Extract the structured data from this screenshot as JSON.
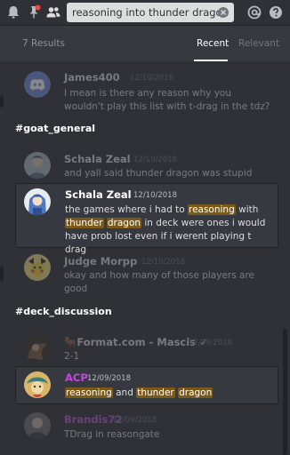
{
  "search": {
    "query": "reasoning into thunder dragon"
  },
  "results": {
    "count_label": "7 Results",
    "sort_tabs": [
      "Recent",
      "Relevant"
    ],
    "active_tab": "Recent"
  },
  "groups": [
    {
      "channel": "",
      "messages": [
        {
          "author": "James400",
          "timestamp": "12/10/2018",
          "content": "I mean is there any reason why you wouldn't play this list with t-drag in the tdz?"
        }
      ]
    },
    {
      "channel": "#goat_general",
      "messages": [
        {
          "author": "Schala Zeal",
          "timestamp": "12/10/2018",
          "content": "and yall said thunder dragon was stupid"
        },
        {
          "author": "Schala Zeal",
          "timestamp": "12/10/2018",
          "segments": [
            "the games where i had to ",
            "reasoning",
            " with ",
            "thunder",
            " ",
            "dragon",
            " in deck were ones i would have prob lost even if i werent playing t drag"
          ]
        },
        {
          "author": "Judge Morpp",
          "timestamp": "12/10/2018",
          "content": "okay and how many of those players are good"
        }
      ]
    },
    {
      "channel": "#deck_discussion",
      "messages": [
        {
          "author": "🐂Format.com - Mascis ✓",
          "timestamp": "12/09/2018",
          "content": "2-1"
        },
        {
          "author": "ACP",
          "timestamp": "12/09/2018",
          "segments": [
            "reasoning",
            " and ",
            "thunder",
            " ",
            "dragon"
          ]
        },
        {
          "author": "Brandis72",
          "timestamp": "12/09/2018",
          "content": "TDrag in reasongate"
        }
      ]
    }
  ],
  "colors": {
    "background": "#2f3136",
    "header": "#36393f",
    "highlight": "#7a5a1b",
    "acp_name": "#c548e0",
    "brandis_name": "#b75bd6"
  },
  "icons": [
    "bell-icon",
    "pin-icon",
    "members-icon",
    "clear-search-icon",
    "mention-icon",
    "help-icon",
    "discord-avatar-icon"
  ]
}
